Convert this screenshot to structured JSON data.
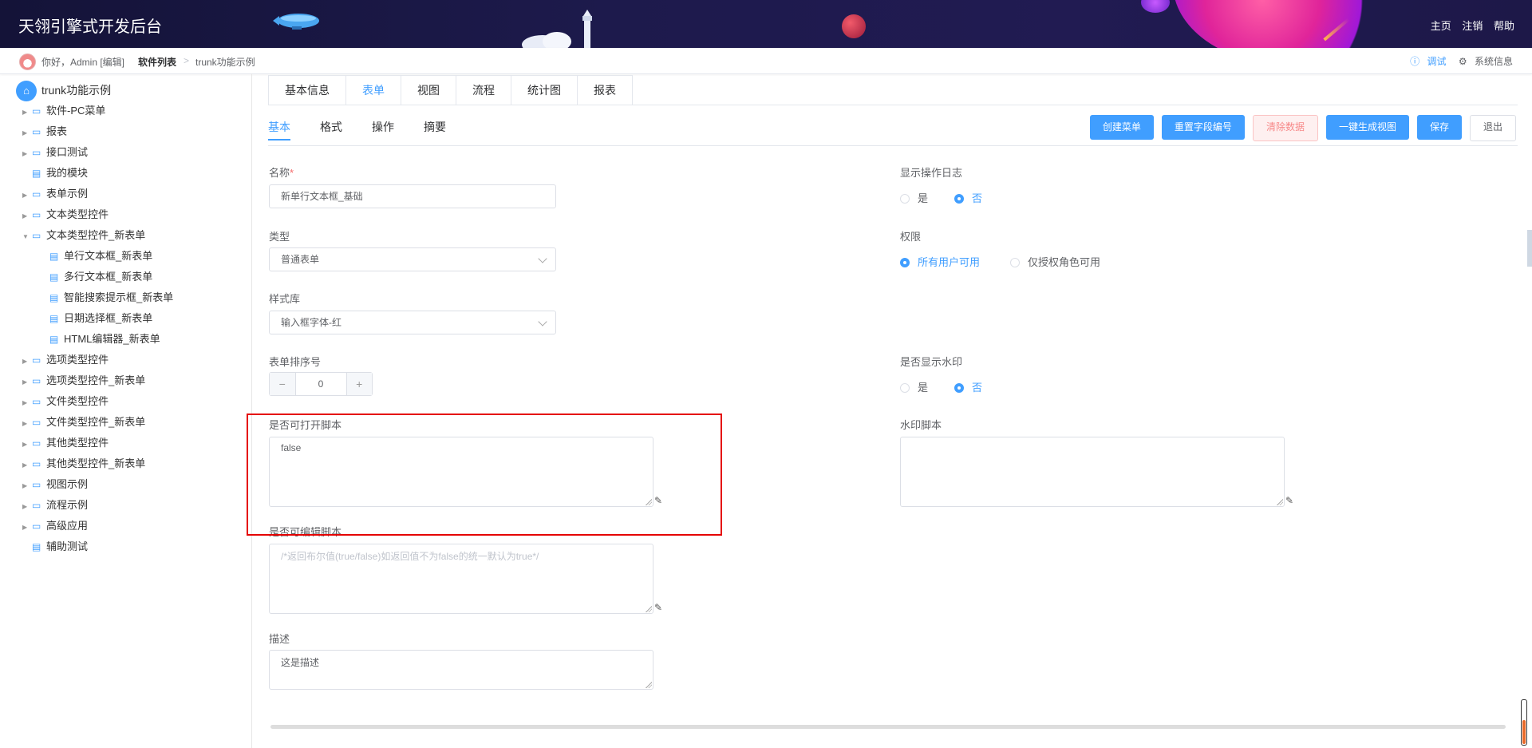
{
  "header": {
    "title": "天翎引擎式开发后台",
    "links": [
      "主页",
      "注销",
      "帮助"
    ]
  },
  "breadcrumb": {
    "greeting": "你好，Admin [编辑]",
    "current": "软件列表",
    "separator": ">",
    "page": "trunk功能示例",
    "debug": "调试",
    "sysinfo": "系统信息"
  },
  "sidebar": {
    "root": "trunk功能示例",
    "items": [
      {
        "label": "软件-PC菜单",
        "type": "folder"
      },
      {
        "label": "报表",
        "type": "folder"
      },
      {
        "label": "接口测试",
        "type": "folder"
      },
      {
        "label": "我的模块",
        "type": "file"
      },
      {
        "label": "表单示例",
        "type": "folder"
      },
      {
        "label": "文本类型控件",
        "type": "folder"
      },
      {
        "label": "文本类型控件_新表单",
        "type": "folder-open"
      },
      {
        "label": "单行文本框_新表单",
        "type": "child"
      },
      {
        "label": "多行文本框_新表单",
        "type": "child"
      },
      {
        "label": "智能搜索提示框_新表单",
        "type": "child"
      },
      {
        "label": "日期选择框_新表单",
        "type": "child"
      },
      {
        "label": "HTML编辑器_新表单",
        "type": "child"
      },
      {
        "label": "选项类型控件",
        "type": "folder"
      },
      {
        "label": "选项类型控件_新表单",
        "type": "folder"
      },
      {
        "label": "文件类型控件",
        "type": "folder"
      },
      {
        "label": "文件类型控件_新表单",
        "type": "folder"
      },
      {
        "label": "其他类型控件",
        "type": "folder"
      },
      {
        "label": "其他类型控件_新表单",
        "type": "folder"
      },
      {
        "label": "视图示例",
        "type": "folder"
      },
      {
        "label": "流程示例",
        "type": "folder"
      },
      {
        "label": "高级应用",
        "type": "folder"
      },
      {
        "label": "辅助测试",
        "type": "file"
      }
    ]
  },
  "tabs": [
    "基本信息",
    "表单",
    "视图",
    "流程",
    "统计图",
    "报表"
  ],
  "active_tab": "表单",
  "subtabs": [
    "基本",
    "格式",
    "操作",
    "摘要"
  ],
  "active_subtab": "基本",
  "buttons": {
    "create_menu": "创建菜单",
    "reset_field_no": "重置字段编号",
    "clear_data": "清除数据",
    "gen_view": "一键生成视图",
    "save": "保存",
    "exit": "退出"
  },
  "form": {
    "name_label": "名称",
    "required_mark": "*",
    "name_value": "新单行文本框_基础",
    "type_label": "类型",
    "type_value": "普通表单",
    "style_label": "样式库",
    "style_value": "输入框字体-红",
    "order_label": "表单排序号",
    "order_value": "0",
    "open_script_label": "是否可打开脚本",
    "open_script_value": "false",
    "edit_script_label": "是否可编辑脚本",
    "edit_script_placeholder": "/*返回布尔值(true/false)如返回值不为false的统一默认为true*/",
    "desc_label": "描述",
    "desc_value": "这是描述",
    "log_label": "显示操作日志",
    "log_options": [
      "是",
      "否"
    ],
    "log_selected": "否",
    "perm_label": "权限",
    "perm_options": [
      "所有用户可用",
      "仅授权角色可用"
    ],
    "perm_selected": "所有用户可用",
    "watermark_label": "是否显示水印",
    "watermark_options": [
      "是",
      "否"
    ],
    "watermark_selected": "否",
    "watermark_script_label": "水印脚本",
    "watermark_script_value": ""
  }
}
